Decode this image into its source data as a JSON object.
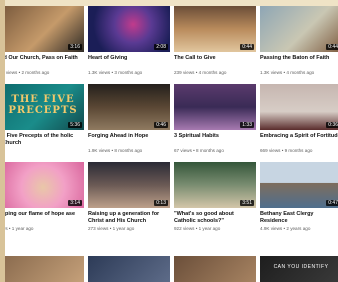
{
  "videos": [
    {
      "title": "ld Our Church, Pass on Faith",
      "meta": "2 views • 2 months ago",
      "duration": "3:16",
      "colors": [
        "#7a5a3d",
        "#c59a6a",
        "#2e2a25"
      ],
      "icon": "painting"
    },
    {
      "title": "Heart of Giving",
      "meta": "1.3K views • 3 months ago",
      "duration": "2:08",
      "colors": [
        "#1b1e57",
        "#5a3a93",
        "#c13b8c"
      ],
      "icon": "spotlight"
    },
    {
      "title": "The Call to Give",
      "meta": "239 views • 4 months ago",
      "duration": "0:44",
      "colors": [
        "#6b4e38",
        "#b98b5c",
        "#e1c69e"
      ],
      "icon": "crowd"
    },
    {
      "title": "Passing the Baton of Faith",
      "meta": "1.3K views • 4 months ago",
      "duration": "0:44",
      "colors": [
        "#8ea6b5",
        "#c9c7b3",
        "#7d5a3e"
      ],
      "icon": "painting"
    },
    {
      "title": "e Five Precepts of the holic Church",
      "meta": "",
      "duration": "5:36",
      "colors": [
        "#0d6b6e",
        "#1a8c8a",
        "#124a4d"
      ],
      "icon": "title-card"
    },
    {
      "title": "Forging Ahead in Hope",
      "meta": "1.9K views • 8 months ago",
      "duration": "0:46",
      "colors": [
        "#24201c",
        "#5a4734",
        "#8f7a60"
      ],
      "icon": "people"
    },
    {
      "title": "3 Spiritual Habits",
      "meta": "67 views • 8 months ago",
      "duration": "1:33",
      "colors": [
        "#5a3a6c",
        "#3a2b56",
        "#a77ab1"
      ],
      "icon": "people"
    },
    {
      "title": "Embracing a Spirit of Fortitude",
      "meta": "669 views • 9 months ago",
      "duration": "0:36",
      "colors": [
        "#c6b6b0",
        "#d7cdc6",
        "#5a2c2c"
      ],
      "icon": "tower"
    },
    {
      "title": "eping our flame of hope ase",
      "meta": "ws • 1 year ago",
      "duration": "3:14",
      "colors": [
        "#d9669d",
        "#f2a0c6",
        "#e9c7a8"
      ],
      "icon": "child"
    },
    {
      "title": "Raising up a generation for Christ and His Church",
      "meta": "273 views • 1 year ago",
      "duration": "0:13",
      "colors": [
        "#2a2a35",
        "#6b5a55",
        "#bda08a"
      ],
      "icon": "crowd"
    },
    {
      "title": "\"What's so good about Catholic schools?\"",
      "meta": "922 views • 1 year ago",
      "duration": "3:51",
      "colors": [
        "#34563a",
        "#7a8d71",
        "#d3c6a9"
      ],
      "icon": "crowd"
    },
    {
      "title": "Bethany East Clergy Residence",
      "meta": "4.9K views • 2 years ago",
      "duration": "0:47",
      "colors": [
        "#4f6f8e",
        "#c7d5e2",
        "#7d6d5e"
      ],
      "icon": "building"
    }
  ],
  "bottom_row": [
    {
      "colors": [
        "#8a6b4e",
        "#c7a27b"
      ],
      "text": ""
    },
    {
      "colors": [
        "#2d3b57",
        "#5f6d8a"
      ],
      "text": ""
    },
    {
      "colors": [
        "#6b4f3a",
        "#a98563"
      ],
      "text": ""
    },
    {
      "colors": [
        "#1e1e1e",
        "#3b3b3b"
      ],
      "text": "CAN YOU IDENTIFY"
    }
  ]
}
